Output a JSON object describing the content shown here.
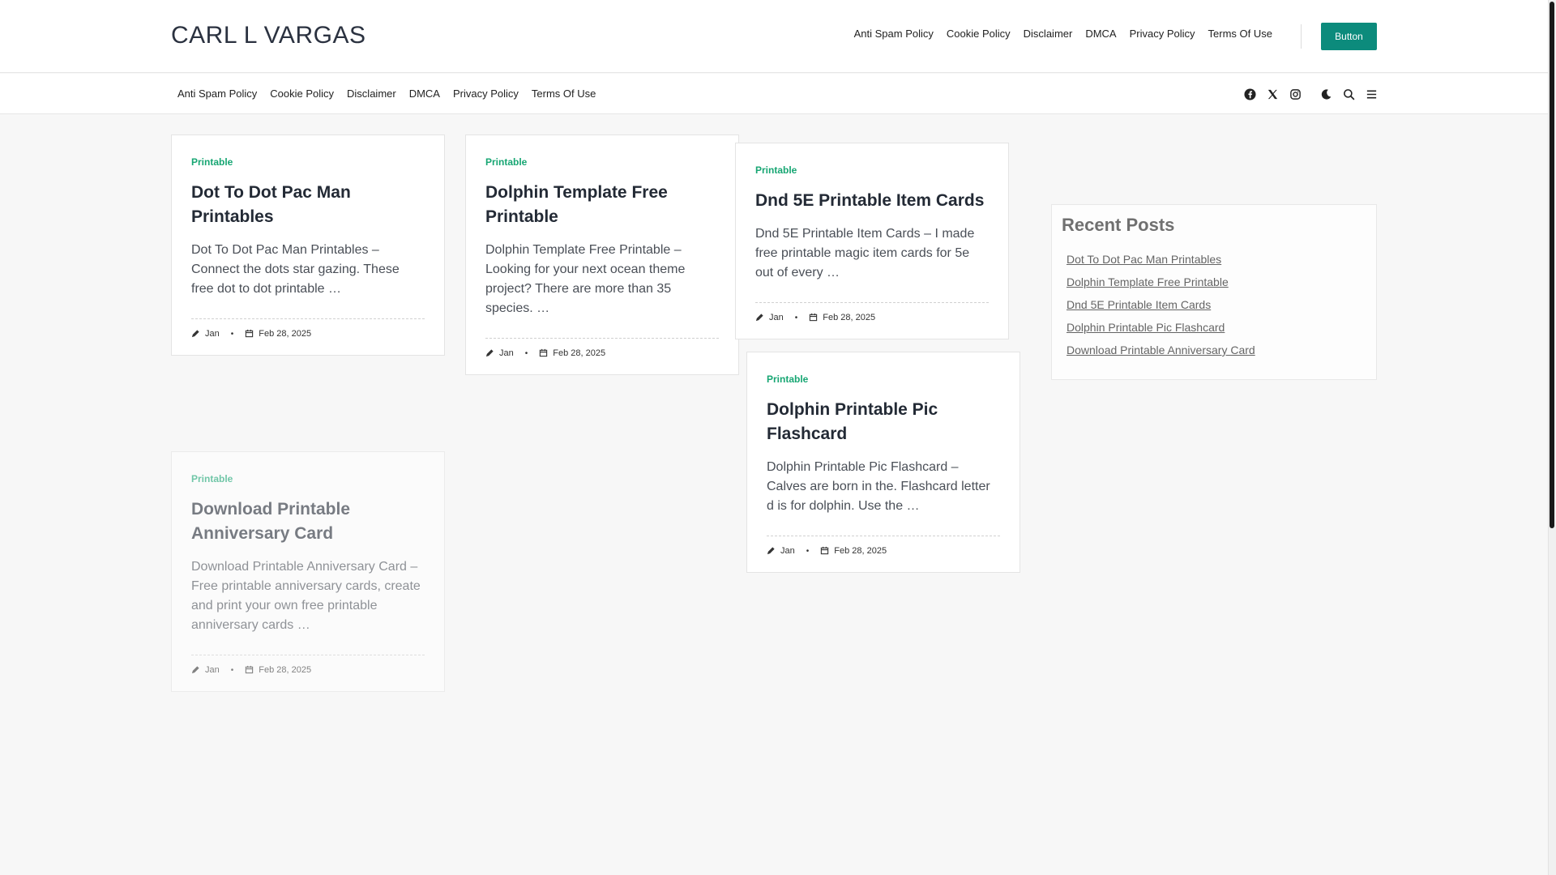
{
  "site": {
    "title": "CARL L VARGAS"
  },
  "top_nav": [
    "Anti Spam Policy",
    "Cookie Policy",
    "Disclaimer",
    "DMCA",
    "Privacy Policy",
    "Terms Of Use"
  ],
  "cta": {
    "label": "Button"
  },
  "sub_nav": [
    "Anti Spam Policy",
    "Cookie Policy",
    "Disclaimer",
    "DMCA",
    "Privacy Policy",
    "Terms Of Use"
  ],
  "header_icons": [
    "facebook-icon",
    "x-twitter-icon",
    "instagram-icon",
    "dark-mode-moon-icon",
    "search-icon",
    "menu-icon"
  ],
  "colors": {
    "accent": "#0c8b7c",
    "category": "#17a673"
  },
  "posts": [
    {
      "category": "Printable",
      "title": "Dot To Dot Pac Man Printables",
      "excerpt": "Dot To Dot Pac Man Printables – Connect the dots star gazing. These free dot to dot printable …",
      "author": "Jan",
      "date": "Feb 28, 2025"
    },
    {
      "category": "Printable",
      "title": "Dolphin Template Free Printable",
      "excerpt": "Dolphin Template Free Printable – Looking for your next ocean theme project? There are more than 35 species. …",
      "author": "Jan",
      "date": "Feb 28, 2025"
    },
    {
      "category": "Printable",
      "title": "Dnd 5E Printable Item Cards",
      "excerpt": "Dnd 5E Printable Item Cards – I made free printable magic item cards for 5e out of every …",
      "author": "Jan",
      "date": "Feb 28, 2025"
    },
    {
      "category": "Printable",
      "title": "Dolphin Printable Pic Flashcard",
      "excerpt": "Dolphin Printable Pic Flashcard – Calves are born in the. Flashcard letter d is for dolphin. Use the …",
      "author": "Jan",
      "date": "Feb 28, 2025"
    },
    {
      "category": "Printable",
      "title": "Download Printable Anniversary Card",
      "excerpt": "Download Printable Anniversary Card – Free printable anniversary cards, create and print your own free printable anniversary cards …",
      "author": "Jan",
      "date": "Feb 28, 2025"
    }
  ],
  "sidebar": {
    "title": "Recent Posts",
    "items": [
      "Dot To Dot Pac Man Printables",
      "Dolphin Template Free Printable",
      "Dnd 5E Printable Item Cards",
      "Dolphin Printable Pic Flashcard",
      "Download Printable Anniversary Card"
    ]
  }
}
